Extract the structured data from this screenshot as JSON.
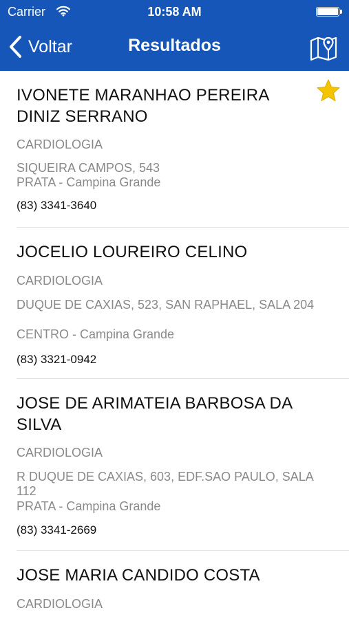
{
  "status_bar": {
    "carrier": "Carrier",
    "time": "10:58 AM"
  },
  "nav": {
    "back_label": "Voltar",
    "title": "Resultados"
  },
  "results": [
    {
      "name": "IVONETE MARANHAO PEREIRA DINIZ SERRANO",
      "specialty": "CARDIOLOGIA",
      "address_line1": "SIQUEIRA CAMPOS, 543",
      "address_line2": "PRATA - Campina Grande",
      "phone": "(83) 3341-3640",
      "favorite": true
    },
    {
      "name": "JOCELIO LOUREIRO CELINO",
      "specialty": "CARDIOLOGIA",
      "address_line1": "DUQUE DE CAXIAS, 523, SAN RAPHAEL, SALA 204",
      "address_line2": "CENTRO - Campina Grande",
      "phone": "(83) 3321-0942",
      "favorite": false
    },
    {
      "name": "JOSE DE ARIMATEIA BARBOSA DA SILVA",
      "specialty": "CARDIOLOGIA",
      "address_line1": "R DUQUE DE CAXIAS, 603, EDF.SAO PAULO, SALA 112",
      "address_line2": "PRATA - Campina Grande",
      "phone": "(83) 3341-2669",
      "favorite": false
    },
    {
      "name": "JOSE MARIA CANDIDO COSTA",
      "specialty": "CARDIOLOGIA"
    }
  ],
  "icons": {
    "back": "chevron-left-icon",
    "map": "map-pin-icon",
    "favorite": "star-icon",
    "wifi": "wifi-icon",
    "battery": "battery-icon"
  },
  "colors": {
    "nav_bar": "#1556b8",
    "favorite_star": "#f5c400",
    "secondary_text": "#8a8a8a"
  }
}
